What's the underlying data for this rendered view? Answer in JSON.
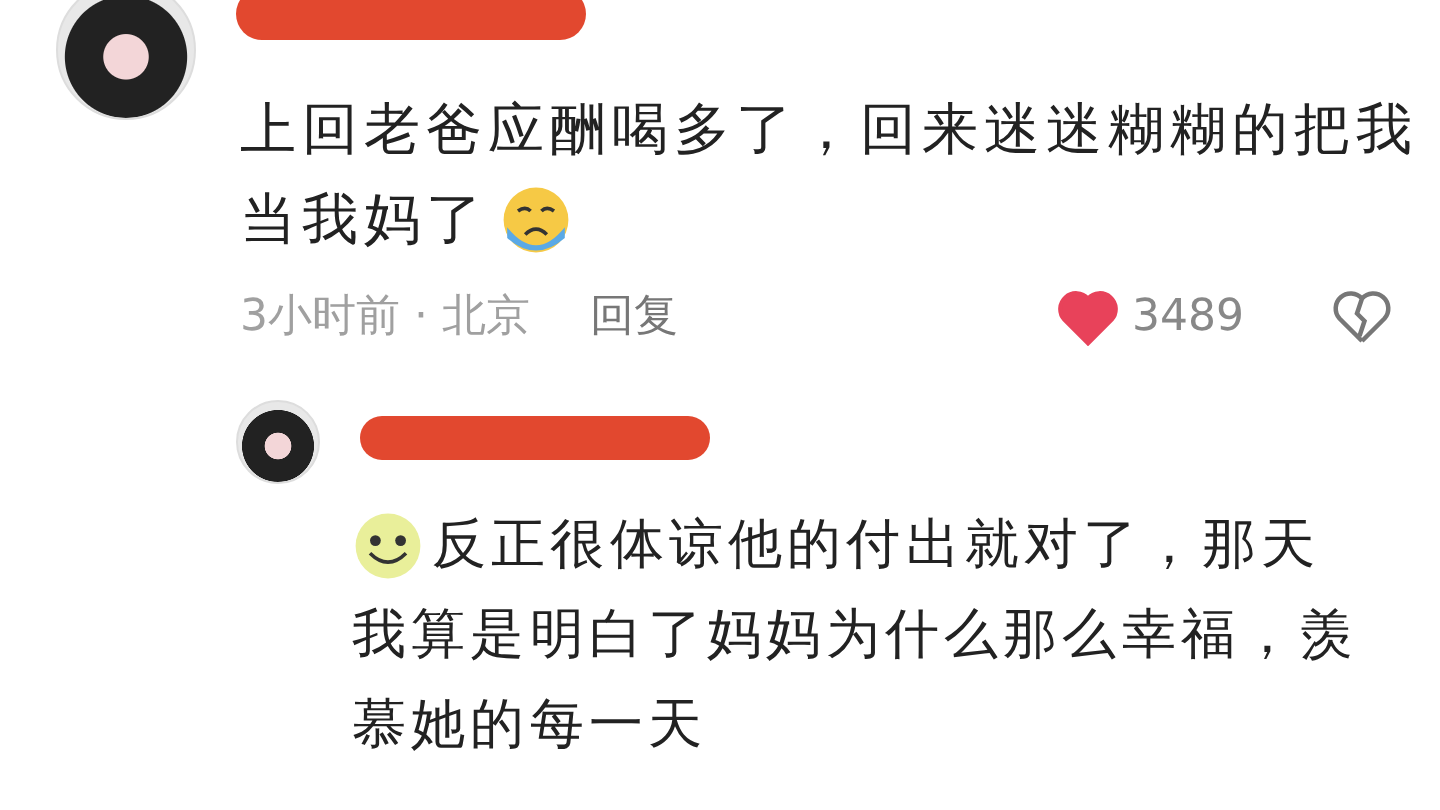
{
  "comment": {
    "text_lines": [
      "上回老爸应酬喝多了，回来迷迷糊糊的把我",
      "当我妈了"
    ],
    "time_location": "3小时前 · 北京",
    "reply_label": "回复",
    "like_count": "3489",
    "liked": true,
    "replies": [
      {
        "text_lines": [
          "反正很体谅他的付出就对了，那天",
          "我算是明白了妈妈为什么那么幸福，羡慕她的每一天"
        ]
      }
    ]
  }
}
